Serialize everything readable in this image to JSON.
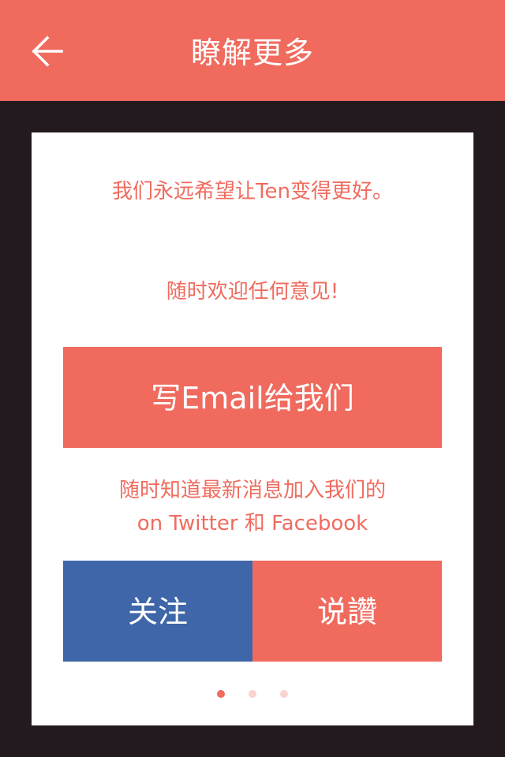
{
  "header": {
    "title": "瞭解更多",
    "back_icon": "arrow-left-icon"
  },
  "card": {
    "message_line_1": "我们永远希望让Ten变得更好。",
    "message_line_2": "随时欢迎任何意见!",
    "email_button_label": "写Email给我们",
    "social_line_1": "随时知道最新消息加入我们的",
    "social_line_2": "on Twitter 和 Facebook",
    "follow_button_label": "关注",
    "say_button_label": "说讚"
  },
  "pagination": {
    "total_pages": 3,
    "current_page": 1
  },
  "colors": {
    "accent": "#f06b5e",
    "facebook_blue": "#3e66a8",
    "background": "#231a1f",
    "card": "#ffffff",
    "dot_inactive": "#f9d3cf"
  }
}
